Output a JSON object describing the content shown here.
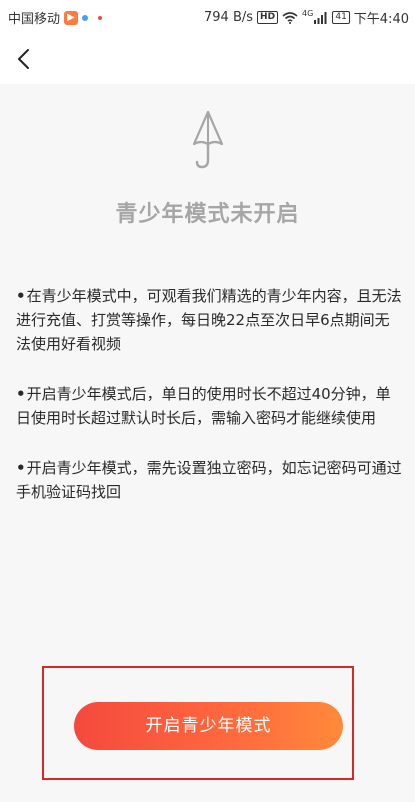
{
  "status_bar": {
    "carrier": "中国移动",
    "app_badge": "▶",
    "speed": "794 B/s",
    "hd": "HD",
    "network": "4G",
    "battery": "41",
    "time": "下午4:40"
  },
  "nav": {
    "back_icon": "chevron-left-icon"
  },
  "hero": {
    "icon": "umbrella-icon",
    "title": "青少年模式未开启"
  },
  "rules": [
    {
      "bullet": "•",
      "text": "在青少年模式中，可观看我们精选的青少年内容，且无法进行充值、打赏等操作，每日晚22点至次日早6点期间无法使用好看视频"
    },
    {
      "bullet": "•",
      "text": "开启青少年模式后，单日的使用时长不超过40分钟，单日使用时长超过默认时长后，需输入密码才能继续使用"
    },
    {
      "bullet": "•",
      "text": "开启青少年模式，需先设置独立密码，如忘记密码可通过手机验证码找回"
    }
  ],
  "cta": {
    "label": "开启青少年模式"
  },
  "colors": {
    "accent_start": "#f4493e",
    "accent_end": "#ff8a3a",
    "highlight_frame": "#d42a2a",
    "title_gray": "#a6a6a6"
  }
}
